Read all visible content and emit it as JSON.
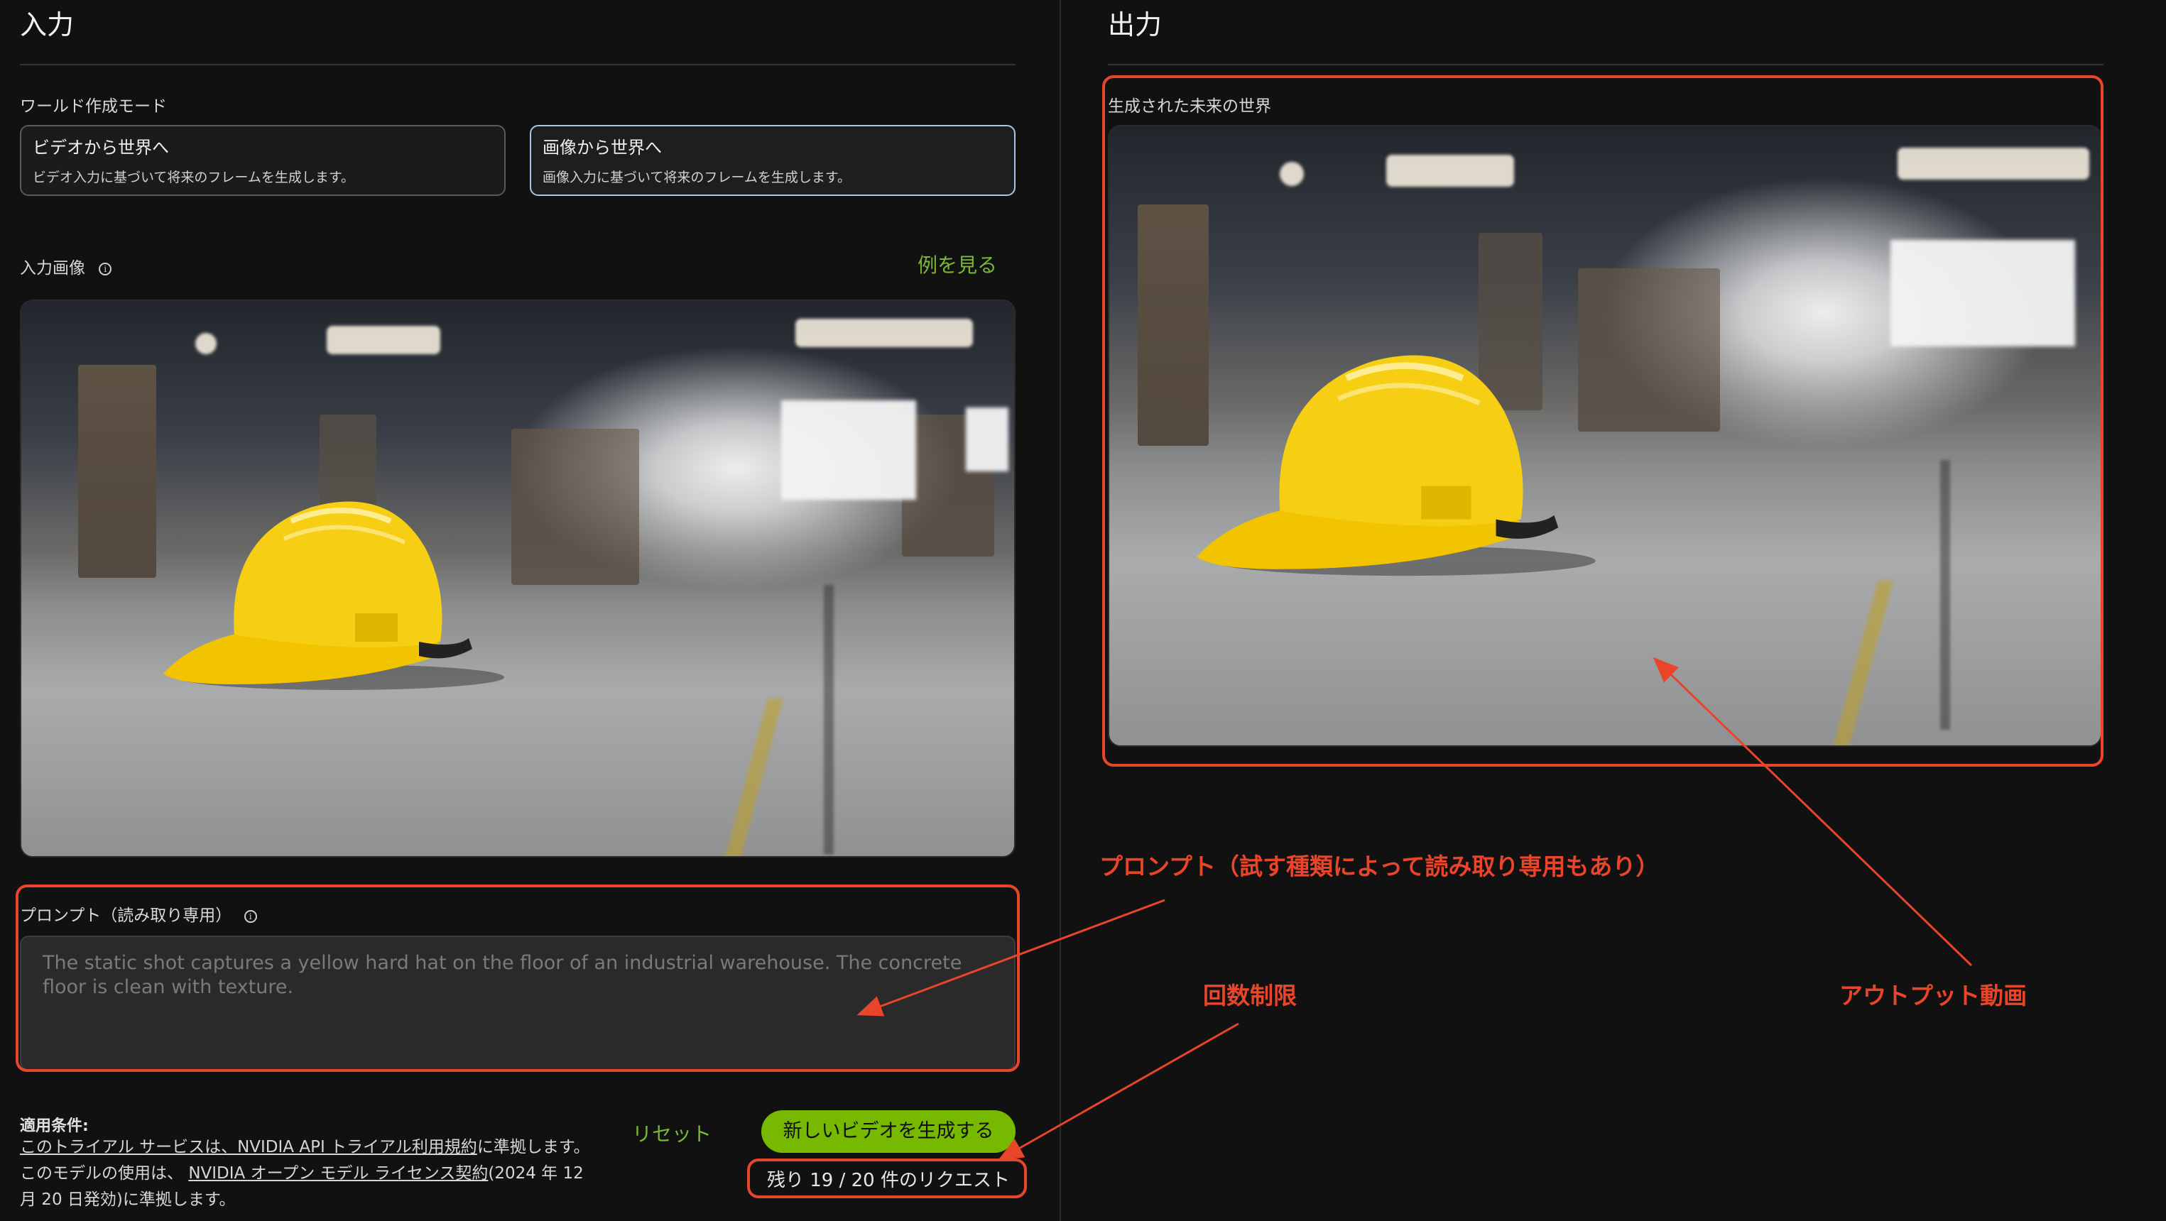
{
  "input": {
    "title": "入力",
    "mode_label": "ワールド作成モード",
    "modes": [
      {
        "title": "ビデオから世界へ",
        "desc": "ビデオ入力に基づいて将来のフレームを生成します。"
      },
      {
        "title": "画像から世界へ",
        "desc": "画像入力に基づいて将来のフレームを生成します。"
      }
    ],
    "image_label": "入力画像",
    "example_link": "例を見る",
    "prompt_label": "プロンプト（読み取り専用）",
    "prompt_text": "The static shot captures a yellow hard hat on the floor of an industrial warehouse. The concrete floor is clean with texture."
  },
  "terms": {
    "title": "適用条件:",
    "line1_link": "このトライアル サービスは、NVIDIA API トライアル利用規約",
    "line1_rest": "に準拠します。このモデルの使用は、",
    "line2_link": "NVIDIA オープン モデル ライセンス契約",
    "line2_rest": "(2024 年 12 月 20 日発効)に準拠します。"
  },
  "actions": {
    "reset": "リセット",
    "generate": "新しいビデオを生成する",
    "remaining": "残り 19 / 20 件のリクエスト"
  },
  "output": {
    "title": "出力",
    "video_label": "生成された未来の世界"
  },
  "annotations": {
    "prompt_note": "プロンプト（試す種類によって読み取り専用もあり）",
    "limit_note": "回数制限",
    "output_note": "アウトプット動画",
    "color": "#e8452a"
  }
}
